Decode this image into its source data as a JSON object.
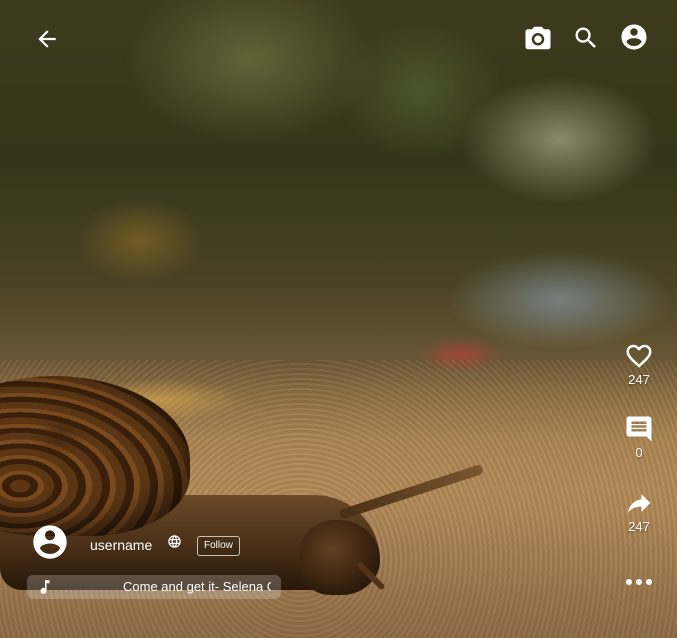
{
  "header": {
    "back_icon": "arrow-left-icon",
    "camera_icon": "camera-icon",
    "search_icon": "search-icon",
    "profile_icon": "account-circle-icon"
  },
  "actions": {
    "like": {
      "icon": "heart-outline-icon",
      "count": "247"
    },
    "comment": {
      "icon": "comment-icon",
      "count": "0"
    },
    "share": {
      "icon": "share-icon",
      "count": "247"
    },
    "more_icon": "more-horizontal-icon"
  },
  "author": {
    "avatar_icon": "account-circle-icon",
    "username": "username",
    "visibility_icon": "globe-icon",
    "follow_label": "Follow"
  },
  "music": {
    "icon": "music-note-icon",
    "track": "Come and get it- Selena Gomez"
  },
  "colors": {
    "icon": "#ffffff",
    "music_bar_bg": "rgba(255,255,255,0.22)"
  }
}
